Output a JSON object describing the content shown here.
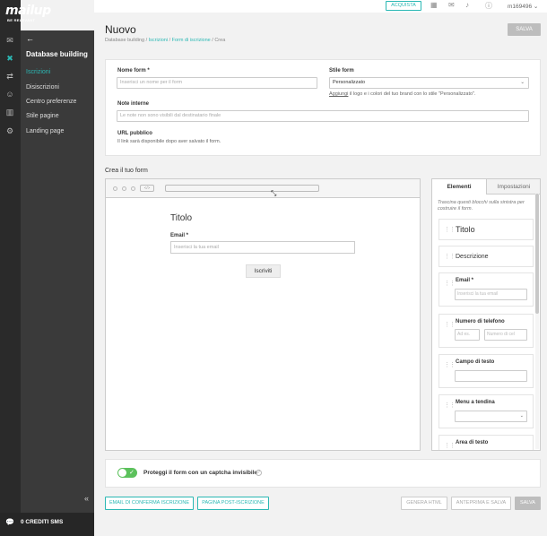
{
  "brand": {
    "name": "mailup",
    "tagline": "BE RELEVANT"
  },
  "rail_icons": [
    "mail-icon",
    "tools-icon",
    "shuffle-icon",
    "user-icon",
    "chart-icon",
    "gear-icon"
  ],
  "sidebar": {
    "back": "←",
    "title": "Database building",
    "items": [
      {
        "label": "Iscrizioni",
        "active": true
      },
      {
        "label": "Disiscrizioni",
        "active": false
      },
      {
        "label": "Centro preferenze",
        "active": false
      },
      {
        "label": "Stile pagine",
        "active": false
      },
      {
        "label": "Landing page",
        "active": false
      }
    ],
    "collapse": "«"
  },
  "credits": {
    "icon": "💬",
    "label": "0 CREDITI SMS"
  },
  "topbar": {
    "acquista": "ACQUISTA",
    "user": "m169496",
    "icons": [
      "calendar-icon",
      "inbox-icon",
      "bell-icon",
      "help-icon"
    ]
  },
  "page": {
    "title": "Nuovo",
    "breadcrumb": [
      "Database building",
      "Iscrizioni",
      "Form di iscrizione",
      "Crea"
    ],
    "save": "SALVA"
  },
  "settings": {
    "name_label": "Nome form *",
    "name_placeholder": "Inserisci un nome per il form",
    "style_label": "Stile form",
    "style_value": "Personalizzato",
    "style_hint_link": "Aggiungi",
    "style_hint_rest": " il logo e i colori del tuo brand con lo stile \"Personalizzato\".",
    "notes_label": "Note interne",
    "notes_placeholder": "Le note non sono visibili dal destinatario finale",
    "url_label": "URL pubblico",
    "url_hint": "Il link sarà disponibile dopo aver salvato il form."
  },
  "builder": {
    "title": "Crea il tuo form",
    "code_btn": "</>",
    "form_title": "Titolo",
    "email_label": "Email *",
    "email_placeholder": "Inserisci la tua email",
    "submit": "Iscriviti"
  },
  "panel": {
    "tabs": [
      "Elementi",
      "Impostazioni"
    ],
    "description": "Trascina questi blocchi sulla sinistra per costruire il form.",
    "blocks": {
      "title": "Titolo",
      "description": "Descrizione",
      "email": "Email *",
      "email_placeholder": "Inserisci la tua email",
      "phone": "Numero di telefono",
      "phone_prefix": "Ad es.",
      "phone_placeholder": "Numero di cel",
      "text_field": "Campo di testo",
      "dropdown": "Menu a tendina",
      "textarea": "Area di testo"
    }
  },
  "captcha": {
    "enabled": true,
    "label": "Proteggi il form con un captcha invisibile",
    "help": "?"
  },
  "footer": {
    "confirm_email": "EMAIL DI CONFERMA ISCRIZIONE",
    "post_page": "PAGINA POST-ISCRIZIONE",
    "html": "GENERA HTML",
    "preview": "ANTEPRIMA E SALVA",
    "save": "SALVA"
  },
  "colors": {
    "accent": "#2bb8b4",
    "toggle_on": "#5cc15c",
    "dark_rail": "#2a2a2a",
    "sidebar": "#3a3a3a"
  }
}
